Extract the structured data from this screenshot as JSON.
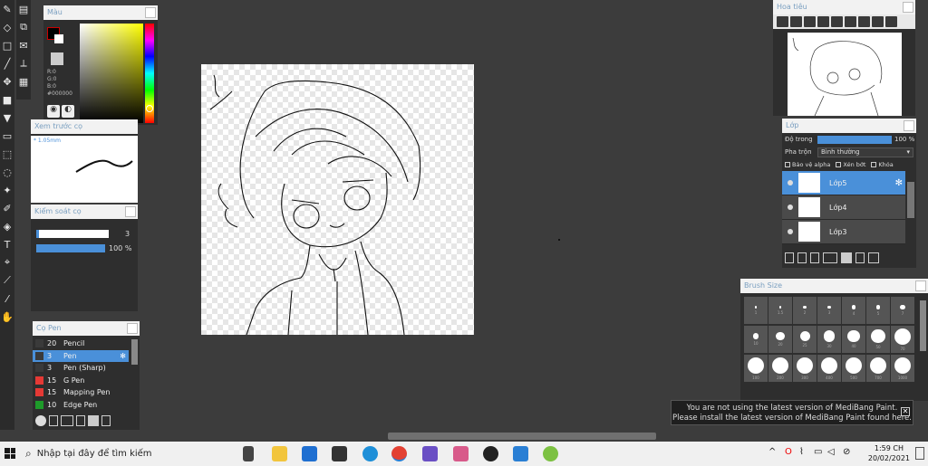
{
  "color_panel": {
    "title": "Màu",
    "r": "R:0",
    "g": "G:0",
    "b": "B:0",
    "hex": "#000000"
  },
  "preview_panel": {
    "title": "Xem trước cọ",
    "size": "* 1.05mm"
  },
  "control_panel": {
    "title": "Kiểm soát cọ",
    "size_value": "3",
    "opacity_value": "100 %",
    "opacity_fraction": 1.0
  },
  "pen_panel": {
    "title": "Cọ Pen",
    "pens": [
      {
        "size": "20",
        "name": "Pencil",
        "color": "#3a3a3a"
      },
      {
        "size": "3",
        "name": "Pen",
        "color": "#3a3a3a",
        "selected": true
      },
      {
        "size": "3",
        "name": "Pen (Sharp)",
        "color": "#3a3a3a"
      },
      {
        "size": "15",
        "name": "G Pen",
        "color": "#e53935"
      },
      {
        "size": "15",
        "name": "Mapping Pen",
        "color": "#e53935"
      },
      {
        "size": "10",
        "name": "Edge Pen",
        "color": "#1e9b2a"
      }
    ]
  },
  "nav_panel": {
    "title": "Hoa tiêu"
  },
  "layer_panel": {
    "title": "Lớp",
    "opacity_label": "Độ trong",
    "opacity_value": "100 %",
    "opacity_fraction": 1.0,
    "blend_label": "Pha trộn",
    "blend_value": "Bình thường",
    "opt_alpha": "Bảo vệ alpha",
    "opt_clip": "Xén bớt",
    "opt_lock": "Khóa",
    "layers": [
      {
        "name": "Lớp5",
        "selected": true
      },
      {
        "name": "Lớp4"
      },
      {
        "name": "Lớp3"
      }
    ]
  },
  "brush_size_panel": {
    "title": "Brush Size",
    "sizes": [
      "1",
      "1.5",
      "2",
      "3",
      "4",
      "5",
      "7",
      "10",
      "20",
      "25",
      "30",
      "40",
      "50",
      "70",
      "100",
      "200",
      "300",
      "400",
      "500",
      "700",
      "1000"
    ]
  },
  "notice": {
    "line1": "You are not using the latest version of MediBang Paint.",
    "line2": "Please install the latest version of MediBang Paint found here.",
    "close": "✕"
  },
  "taskbar": {
    "search_placeholder": "Nhập tại đây để tìm kiếm",
    "time": "1:59 CH",
    "date": "20/02/2021"
  },
  "colors": {
    "accent": "#4a90d9",
    "panel_bg": "#2e2e2e",
    "workspace": "#3c3c3c"
  }
}
